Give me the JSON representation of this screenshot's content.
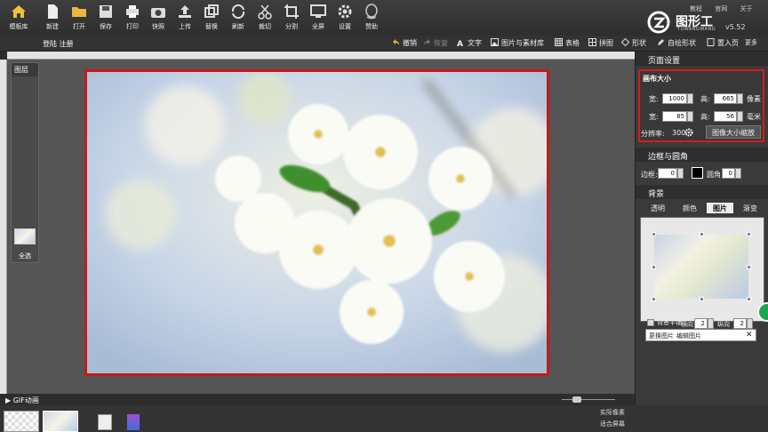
{
  "toolbar": {
    "buttons": [
      {
        "label": "模板库",
        "icon": "home-icon"
      },
      {
        "label": "新建",
        "icon": "new-file-icon"
      },
      {
        "label": "打开",
        "icon": "folder-open-icon"
      },
      {
        "label": "保存",
        "icon": "save-icon"
      },
      {
        "label": "打印",
        "icon": "print-icon"
      },
      {
        "label": "快照",
        "icon": "camera-icon"
      },
      {
        "label": "上传",
        "icon": "upload-icon"
      },
      {
        "label": "替换",
        "icon": "replace-icon"
      },
      {
        "label": "刷新",
        "icon": "refresh-icon"
      },
      {
        "label": "裁切",
        "icon": "scissors-icon"
      },
      {
        "label": "分割",
        "icon": "crop-icon"
      },
      {
        "label": "全屏",
        "icon": "monitor-icon"
      },
      {
        "label": "设置",
        "icon": "gear-icon"
      },
      {
        "label": "赞助",
        "icon": "sponsor-icon"
      }
    ]
  },
  "brand": {
    "links": [
      "教程",
      "官网",
      "关于"
    ],
    "name": "图形工",
    "sub": "TUWANGWANG",
    "version": "v5.52"
  },
  "bar2": {
    "login": "登陆",
    "register": "注册",
    "undo": "撤销",
    "redo": "恢复",
    "items": [
      "文字",
      "图片与素材库",
      "表格",
      "拼图",
      "形状",
      "自绘形状",
      "置入页",
      "更多"
    ]
  },
  "layers": {
    "title": "图层",
    "select_all": "全选"
  },
  "rightPanel": {
    "page_settings": "页面设置",
    "canvas_size": "画布大小",
    "width_label": "宽:",
    "height_label": "高:",
    "width_px": "1000",
    "height_px": "665",
    "unit_px": "像素",
    "width_mm": "85",
    "height_mm": "56",
    "unit_mm": "毫米",
    "resolution_label": "分辨率:",
    "resolution": "300",
    "scale_button": "图像大小缩放",
    "border_section": "边框与圆角",
    "border_label": "边框:",
    "border_value": "0",
    "corner_label": "圆角:",
    "corner_value": "0",
    "background_section": "背景",
    "tabs": [
      "透明",
      "颜色",
      "图片",
      "渐变"
    ],
    "tile_label": "背景平铺",
    "horizontal_label": "横向",
    "horizontal_value": "2",
    "vertical_label": "纵向",
    "vertical_value": "2",
    "change_image": "更换图片",
    "edit_image": "编辑图片"
  },
  "bottom": {
    "gif_title": "GIF动画",
    "side_buttons": [
      "实际像素",
      "适合屏幕"
    ]
  },
  "colors": {
    "highlight_red": "#d61d1d",
    "panel_dark": "#3a3a3a",
    "green_button": "#1aa84a"
  }
}
